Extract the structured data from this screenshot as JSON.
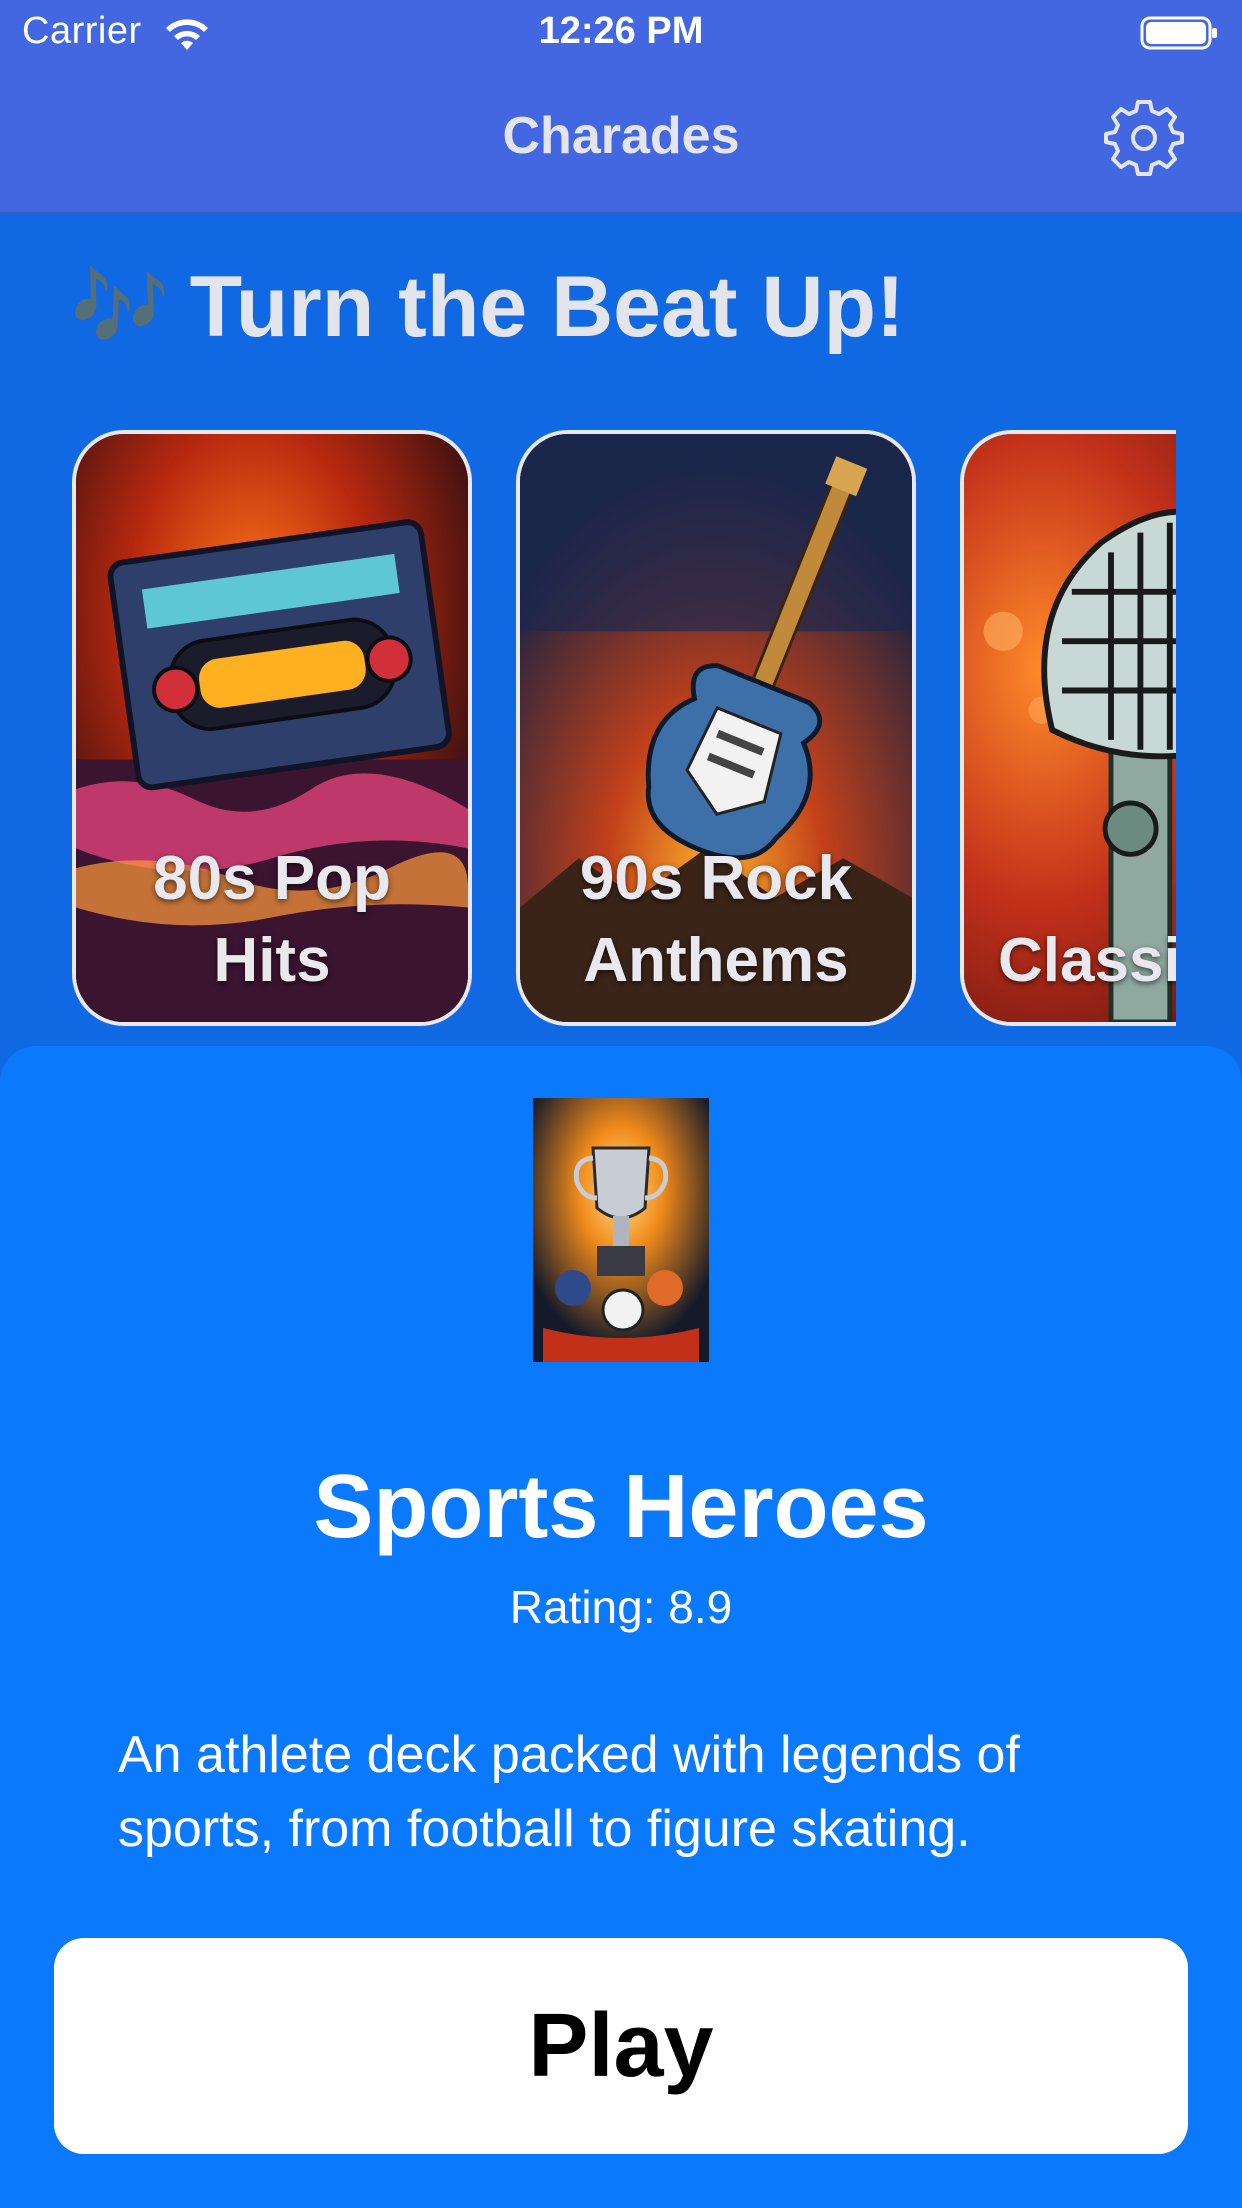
{
  "status_bar": {
    "carrier": "Carrier",
    "time": "12:26 PM",
    "wifi_icon": "wifi-icon",
    "battery_icon": "battery-icon"
  },
  "nav": {
    "title": "Charades",
    "settings_icon": "gear-icon"
  },
  "section": {
    "icon": "🎶",
    "title": "Turn the Beat Up!"
  },
  "cards": [
    {
      "label": "80s Pop Hits",
      "art": "cassette-tape"
    },
    {
      "label": "90s Rock Anthems",
      "art": "electric-guitar"
    },
    {
      "label": "Classic Jazz T",
      "art": "microphone"
    }
  ],
  "selected_deck": {
    "art": "trophy",
    "title": "Sports Heroes",
    "rating": "Rating: 8.9",
    "description": "An athlete deck packed with legends of sports, from football to figure skating."
  },
  "play_button": {
    "label": "Play"
  },
  "colors": {
    "nav_bar": "#4267e0",
    "background": "#1068e2",
    "sheet": "#0a79fb",
    "play_button_bg": "#ffffff"
  }
}
